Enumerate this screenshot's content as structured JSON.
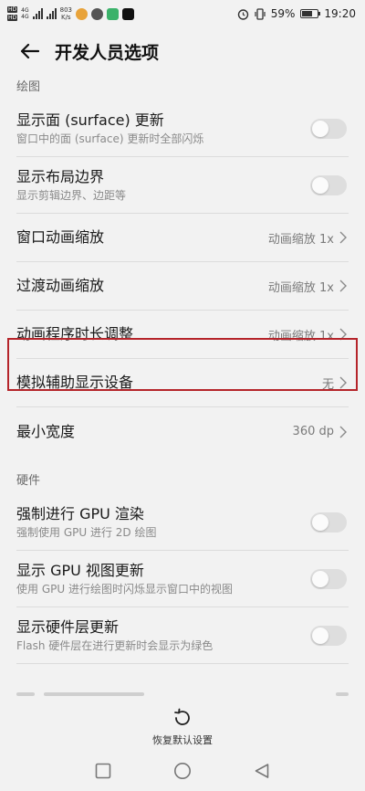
{
  "status_bar": {
    "sim1": "HD",
    "sim2": "HD",
    "net1": "4G",
    "net2": "4G",
    "speed": "803",
    "speed_unit": "K/s",
    "battery": "59%",
    "time": "19:20"
  },
  "header": {
    "title": "开发人员选项"
  },
  "sections": {
    "drawing": "绘图",
    "hardware": "硬件"
  },
  "drawing_items": {
    "surface_update": {
      "title": "显示面 (surface) 更新",
      "subtitle": "窗口中的面 (surface) 更新时全部闪烁"
    },
    "layout_bounds": {
      "title": "显示布局边界",
      "subtitle": "显示剪辑边界、边距等"
    },
    "window_anim": {
      "title": "窗口动画缩放",
      "value": "动画缩放 1x"
    },
    "transition_anim": {
      "title": "过渡动画缩放",
      "value": "动画缩放 1x"
    },
    "animator_duration": {
      "title": "动画程序时长调整",
      "value": "动画缩放 1x"
    },
    "simulate_display": {
      "title": "模拟辅助显示设备",
      "value": "无"
    },
    "smallest_width": {
      "title": "最小宽度",
      "value": "360 dp"
    }
  },
  "hardware_items": {
    "force_gpu": {
      "title": "强制进行 GPU 渲染",
      "subtitle": "强制使用 GPU 进行 2D 绘图"
    },
    "gpu_view_updates": {
      "title": "显示 GPU 视图更新",
      "subtitle": "使用 GPU 进行绘图时闪烁显示窗口中的视图"
    },
    "hw_layers": {
      "title": "显示硬件层更新",
      "subtitle": "Flash 硬件层在进行更新时会显示为绿色"
    }
  },
  "bottom": {
    "reset_label": "恢复默认设置"
  },
  "toggles": {
    "surface_update": false,
    "layout_bounds": false,
    "force_gpu": false,
    "gpu_view_updates": false,
    "hw_layers": false
  },
  "colors": {
    "highlight": "#b5242a",
    "background": "#f2f2f2"
  }
}
